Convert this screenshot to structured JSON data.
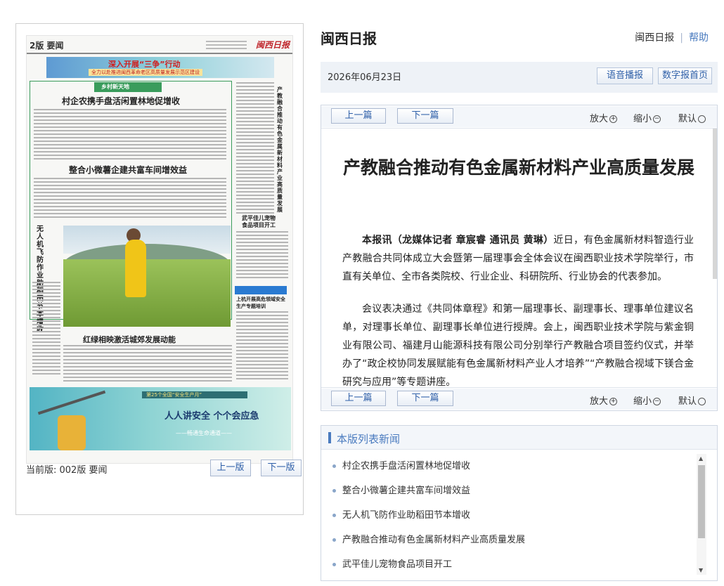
{
  "site": {
    "title": "闽西日报",
    "top_link": "闽西日报",
    "help": "帮助"
  },
  "date_bar": {
    "date": "2026年06月23日",
    "voice": "语音播报",
    "home": "数字报首页"
  },
  "page_image": {
    "edition_label": "2版 要闻",
    "brand": "闽西日报",
    "banner_title": "深入开展“三争”行动",
    "banner_sub": "全力以赴推进闽西革命老区高质量发展示范区建设",
    "section_tag": "乡村新天地",
    "headline1": "村企农携手盘活闲置林地促增收",
    "headline2": "整合小微薯企建共富车间增效益",
    "vert_headline": "无人机飞防作业助稻田节本增收",
    "right_vert": "产教融合推动有色金属新材料产业高质量发展",
    "side_head1": "武平佳儿宠物",
    "side_head2": "食品项目开工",
    "right_head3": "上杭开展高危领域安全生产专题培训",
    "bottom_head": "红绿相映激活城郊发展动能",
    "bottom_banner_top": "第25个全国“安全生产月”",
    "bottom_banner_main": "人人讲安全 个个会应急",
    "bottom_banner_sub": "——畅通生命通道——"
  },
  "left_footer": {
    "current_edition": "当前版: 002版 要闻",
    "prev": "上一版",
    "next": "下一版"
  },
  "article_toolbar": {
    "prev": "上一篇",
    "next": "下一篇",
    "zoom_in": "放大",
    "zoom_out": "缩小",
    "default": "默认"
  },
  "article": {
    "title": "产教融合推动有色金属新材料产业高质量发展",
    "byline": "本报讯（龙媒体记者 章宸睿 通讯员 黄琳）",
    "p1_rest": "近日，有色金属新材料智造行业产教融合共同体成立大会暨第一届理事会全体会议在闽西职业技术学院举行，市直有关单位、全市各类院校、行业企业、科研院所、行业协会的代表参加。",
    "p2": "会议表决通过《共同体章程》和第一届理事长、副理事长、理事单位建议名单，对理事长单位、副理事长单位进行授牌。会上，闽西职业技术学院与紫金铜业有限公司、福建月山能源科技有限公司分别举行产教融合项目签约仪式，并举办了“政企校协同发展赋能有色金属新材料产业人才培养”“产教融合视域下镁合金研究与应用”等专题讲座。"
  },
  "news_section": {
    "title": "本版列表新闻",
    "items": [
      "村企农携手盘活闲置林地促增收",
      "整合小微薯企建共富车间增效益",
      "无人机飞防作业助稻田节本增收",
      "产教融合推动有色金属新材料产业高质量发展",
      "武平佳儿宠物食品项目开工"
    ]
  },
  "colors": {
    "accent": "#4a7bbf",
    "section_green": "#3a9c5c",
    "brand_red": "#c0272d"
  }
}
